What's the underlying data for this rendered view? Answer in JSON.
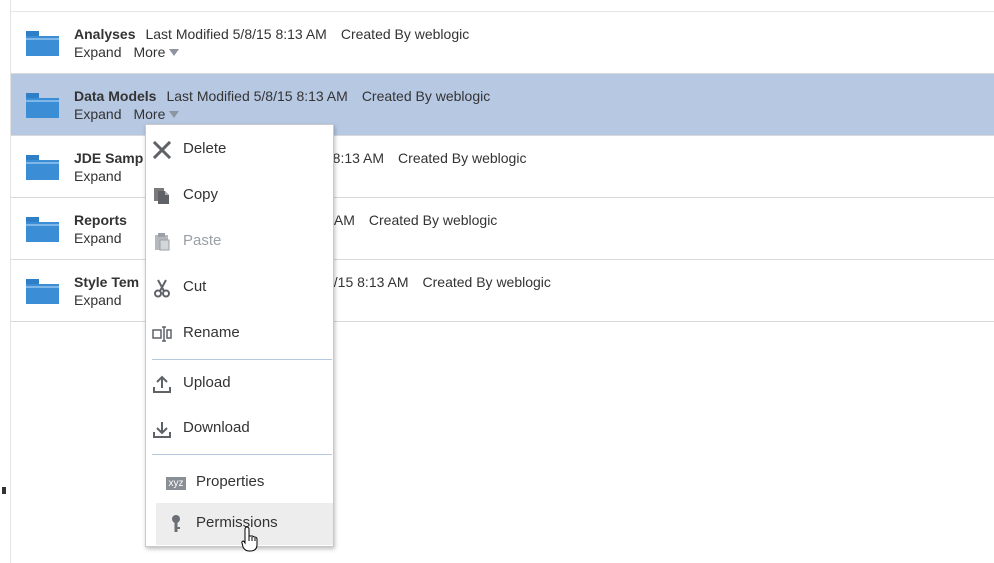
{
  "folders": [
    {
      "name": "Analyses",
      "modified": "Last Modified 5/8/15 8:13 AM",
      "created": "Created By weblogic",
      "expand": "Expand",
      "more": "More",
      "selected": false
    },
    {
      "name": "Data Models",
      "modified": "Last Modified 5/8/15 8:13 AM",
      "created": "Created By weblogic",
      "expand": "Expand",
      "more": "More",
      "selected": true
    },
    {
      "name": "JDE Samp",
      "modified": "5 8:13 AM",
      "created": "Created By weblogic",
      "expand": "Expand",
      "more": "",
      "selected": false
    },
    {
      "name": "Reports",
      "modified": "3 AM",
      "created": "Created By weblogic",
      "expand": "Expand",
      "more": "",
      "selected": false
    },
    {
      "name": "Style Tem",
      "modified": "3/15 8:13 AM",
      "created": "Created By weblogic",
      "expand": "Expand",
      "more": "",
      "selected": false
    }
  ],
  "menu": {
    "items": [
      {
        "label": "Delete",
        "icon": "delete-x-icon",
        "disabled": false
      },
      {
        "label": "Copy",
        "icon": "copy-icon",
        "disabled": false
      },
      {
        "label": "Paste",
        "icon": "paste-icon",
        "disabled": true
      },
      {
        "label": "Cut",
        "icon": "scissors-icon",
        "disabled": false
      },
      {
        "label": "Rename",
        "icon": "rename-icon",
        "disabled": false
      },
      {
        "label": "Upload",
        "icon": "upload-icon",
        "disabled": false
      },
      {
        "label": "Download",
        "icon": "download-icon",
        "disabled": false
      },
      {
        "label": "Properties",
        "icon": "properties-xyz-icon",
        "icon_text": "xyz",
        "disabled": false
      },
      {
        "label": "Permissions",
        "icon": "key-icon",
        "disabled": false,
        "hovered": true
      }
    ]
  },
  "colors": {
    "selected_row": "#b7c8e3",
    "folder_icon": "#3b8ed6",
    "separator": "#b6c8de"
  }
}
